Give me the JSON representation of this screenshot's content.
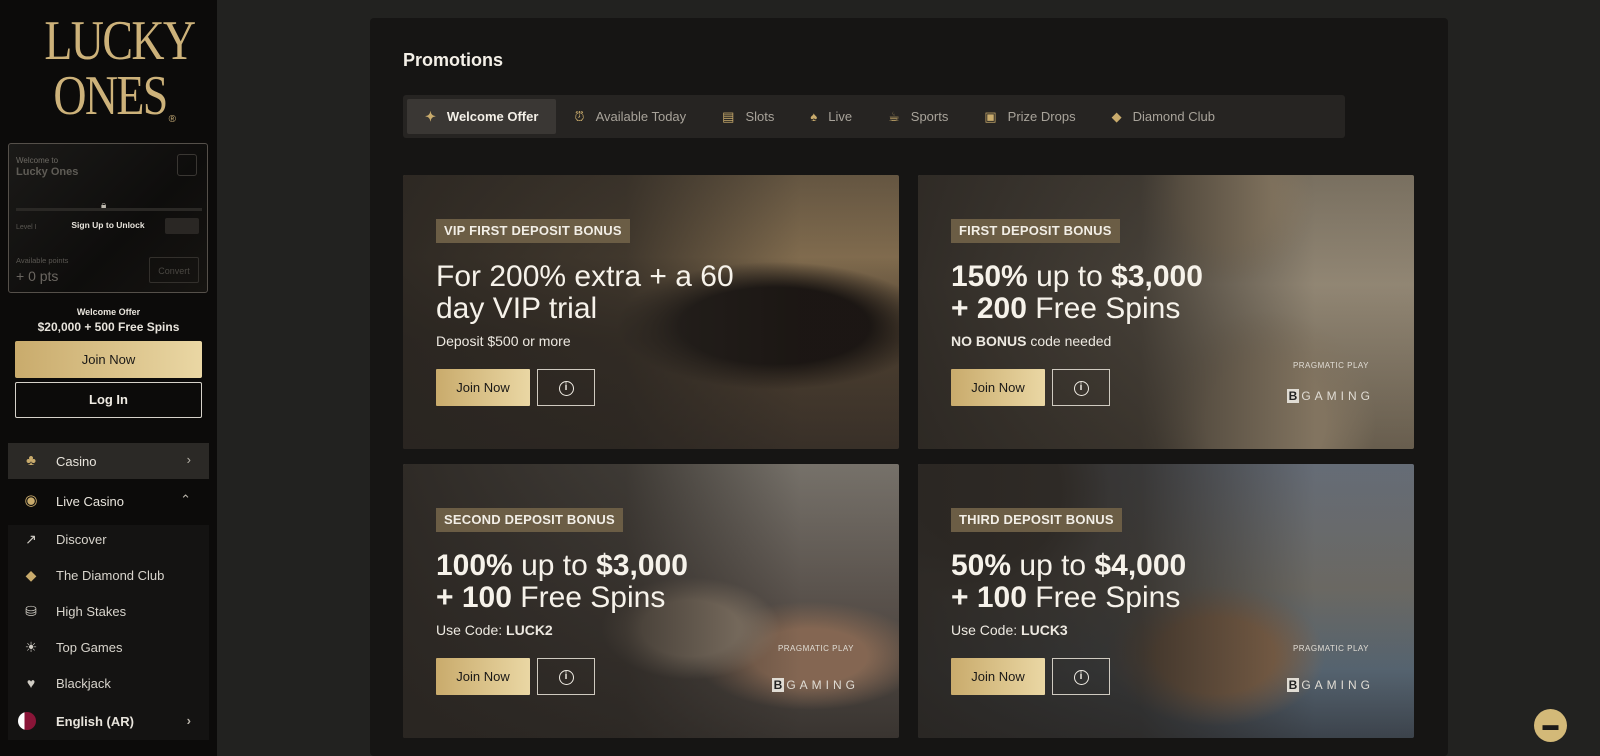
{
  "brand": {
    "line1": "LUCKY",
    "line2": "ONES",
    "reg": "®"
  },
  "welcome_card": {
    "pre": "Welcome to",
    "title": "Lucky Ones",
    "unlock": "Sign Up to Unlock",
    "level": "Level I",
    "points_label": "Available points",
    "points": "+ 0 pts",
    "convert": "Convert"
  },
  "offer": {
    "pre": "Welcome Offer",
    "main": "$20,000 + 500 Free Spins"
  },
  "auth": {
    "join": "Join Now",
    "login": "Log In"
  },
  "nav": {
    "casino": "Casino",
    "live_casino": "Live Casino",
    "sub": [
      {
        "label": "Discover",
        "icon": "rocket-icon"
      },
      {
        "label": "The Diamond Club",
        "icon": "diamond-icon"
      },
      {
        "label": "High Stakes",
        "icon": "coins-icon"
      },
      {
        "label": "Top Games",
        "icon": "sun-icon"
      },
      {
        "label": "Blackjack",
        "icon": "card-icon"
      }
    ],
    "language": "English (AR)"
  },
  "page": {
    "title": "Promotions",
    "tabs": [
      {
        "label": "Welcome Offer",
        "active": true,
        "icon": "percent-icon"
      },
      {
        "label": "Available Today",
        "icon": "alarm-icon"
      },
      {
        "label": "Slots",
        "icon": "slots-icon"
      },
      {
        "label": "Live",
        "icon": "live-cards-icon"
      },
      {
        "label": "Sports",
        "icon": "trophy-icon"
      },
      {
        "label": "Prize Drops",
        "icon": "gift-icon"
      },
      {
        "label": "Diamond Club",
        "icon": "diamond-icon"
      }
    ]
  },
  "cards": [
    {
      "tag": "VIP FIRST DEPOSIT BONUS",
      "h1": "For 200% extra + a 60",
      "h2": "day VIP trial",
      "sub_plain": "Deposit $500 or more",
      "join": "Join Now"
    },
    {
      "tag": "FIRST DEPOSIT BONUS",
      "h1a": "150%",
      "h1b": " up to ",
      "h1c": "$3,000",
      "h2a": "+ 200",
      "h2b": " Free Spins",
      "sub_bold": "NO BONUS",
      "sub_rest": " code needed",
      "join": "Join Now",
      "provider1": "PRAGMATIC PLAY",
      "provider2": "GAMING",
      "provider2_mark": "B"
    },
    {
      "tag": "SECOND DEPOSIT BONUS",
      "h1a": "100%",
      "h1b": " up to ",
      "h1c": "$3,000",
      "h2a": "+ 100",
      "h2b": " Free Spins",
      "sub_rest": "Use Code: ",
      "sub_bold": "LUCK2",
      "join": "Join Now",
      "provider1": "PRAGMATIC PLAY",
      "provider2": "GAMING",
      "provider2_mark": "B"
    },
    {
      "tag": "THIRD DEPOSIT BONUS",
      "h1a": "50%",
      "h1b": " up to ",
      "h1c": "$4,000",
      "h2a": "+ 100",
      "h2b": " Free Spins",
      "sub_rest": "Use Code: ",
      "sub_bold": "LUCK3",
      "join": "Join Now",
      "provider1": "PRAGMATIC PLAY",
      "provider2": "GAMING",
      "provider2_mark": "B"
    }
  ],
  "colors": {
    "gold": "#c9ab6c",
    "bg": "#222220",
    "panel": "#161514",
    "tag": "#6b5d45"
  }
}
